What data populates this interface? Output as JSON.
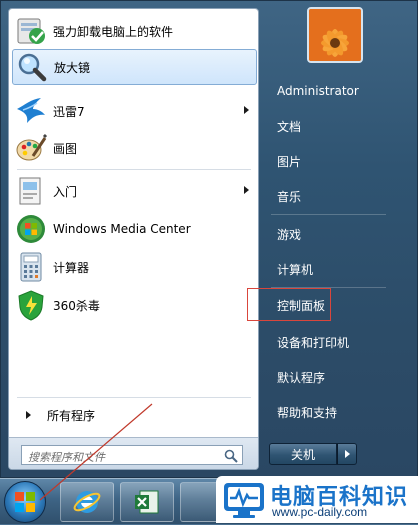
{
  "start_menu": {
    "programs": [
      {
        "label": "强力卸载电脑上的软件",
        "icon": "uninstaller-icon",
        "has_submenu": false,
        "selected": false
      },
      {
        "label": "放大镜",
        "icon": "magnifier-icon",
        "has_submenu": false,
        "selected": true
      },
      {
        "label": "迅雷7",
        "icon": "thunder-icon",
        "has_submenu": true,
        "selected": false
      },
      {
        "label": "画图",
        "icon": "paint-icon",
        "has_submenu": false,
        "selected": false
      },
      {
        "label": "入门",
        "icon": "getting-started-icon",
        "has_submenu": true,
        "selected": false
      },
      {
        "label": "Windows Media Center",
        "icon": "media-center-icon",
        "has_submenu": false,
        "selected": false
      },
      {
        "label": "计算器",
        "icon": "calculator-icon",
        "has_submenu": false,
        "selected": false
      },
      {
        "label": "360杀毒",
        "icon": "360-antivirus-icon",
        "has_submenu": false,
        "selected": false
      }
    ],
    "all_programs_label": "所有程序",
    "search_placeholder": "搜索程序和文件"
  },
  "right_pane": {
    "items": [
      {
        "label": "Administrator"
      },
      {
        "label": "文档"
      },
      {
        "label": "图片"
      },
      {
        "label": "音乐"
      },
      {
        "label": "游戏"
      },
      {
        "label": "计算机"
      },
      {
        "label": "控制面板",
        "highlighted": true
      },
      {
        "label": "设备和打印机"
      },
      {
        "label": "默认程序"
      },
      {
        "label": "帮助和支持"
      }
    ],
    "shutdown_label": "关机"
  },
  "taskbar": {
    "items": [
      "start-orb",
      "internet-explorer-icon",
      "excel-icon"
    ]
  },
  "watermark": {
    "title": "电脑百科知识",
    "url": "www.pc-daily.com"
  },
  "colors": {
    "highlight_box": "#d9463c",
    "annotation_line": "#c0392b",
    "accent_blue": "#1a73c9"
  }
}
